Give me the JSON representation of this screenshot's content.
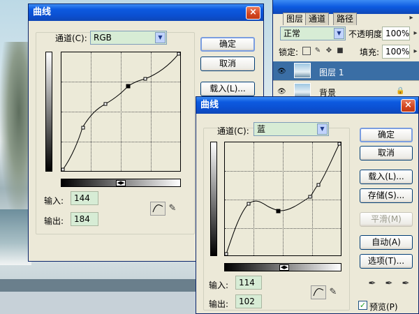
{
  "layers_panel": {
    "tabs": [
      "图层",
      "通道",
      "路径"
    ],
    "blend_mode": "正常",
    "opacity_label": "不透明度:",
    "opacity_value": "100%",
    "lock_label": "锁定:",
    "fill_label": "填充:",
    "fill_value": "100%",
    "layers": [
      {
        "name": "图层 1",
        "selected": true
      },
      {
        "name": "背景",
        "selected": false
      }
    ]
  },
  "dialog1": {
    "title": "曲线",
    "close": "×",
    "channel_label": "通道(C):",
    "channel_value": "RGB",
    "buttons": {
      "ok": "确定",
      "cancel": "取消",
      "load": "载入(L)..."
    },
    "input_label": "输入:",
    "input_value": "144",
    "output_label": "输出:",
    "output_value": "184",
    "slider_mark": "◀▶"
  },
  "dialog2": {
    "title": "曲线",
    "close": "×",
    "channel_label": "通道(C):",
    "channel_value": "蓝",
    "buttons": {
      "ok": "确定",
      "cancel": "取消",
      "load": "载入(L)...",
      "save": "存储(S)...",
      "smooth": "平滑(M)",
      "auto": "自动(A)",
      "options": "选项(T)..."
    },
    "input_label": "输入:",
    "input_value": "114",
    "output_label": "输出:",
    "output_value": "102",
    "preview_label": "预览(P)",
    "preview_checked": true,
    "slider_mark": "◀▶"
  }
}
